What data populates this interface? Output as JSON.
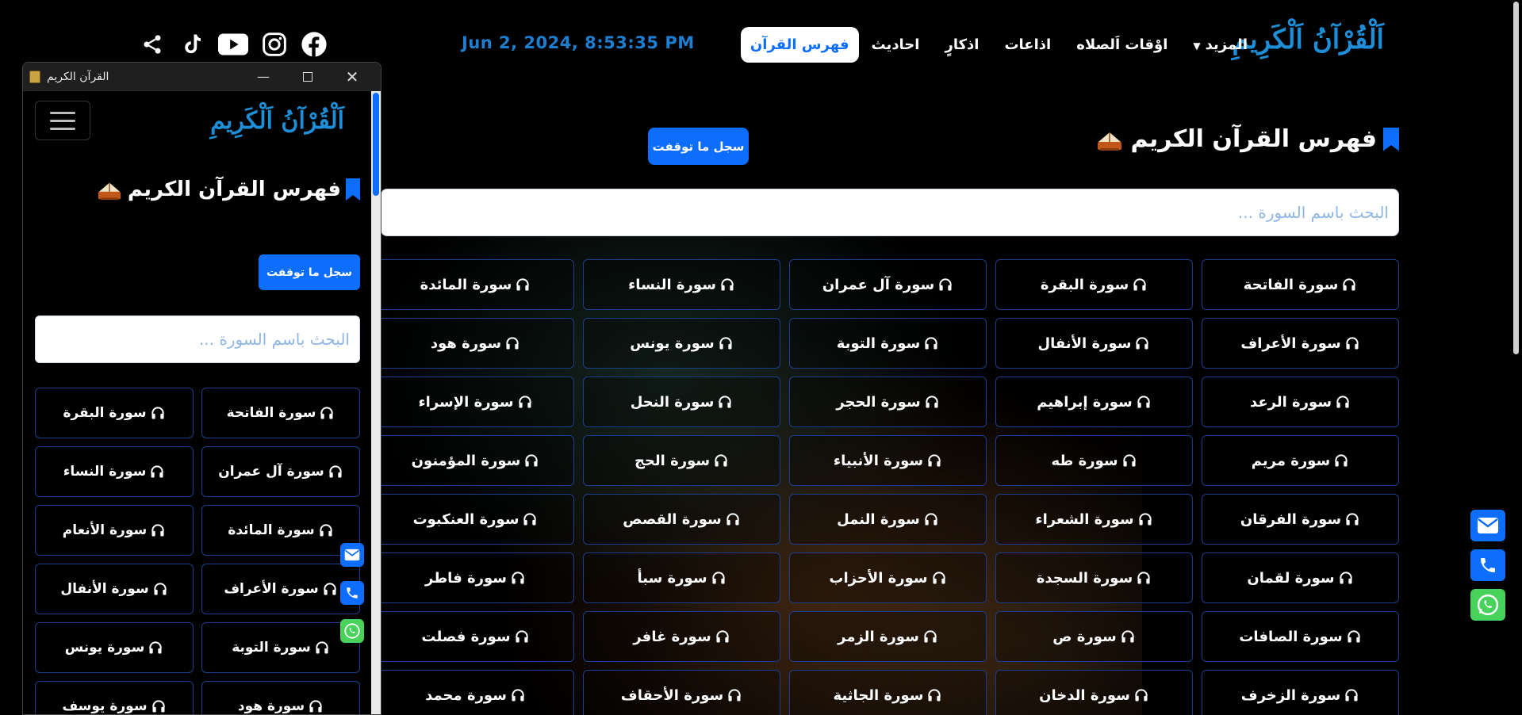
{
  "nav": {
    "brand": "اَلْقُرْآنُ اَلْكَرِيمِ",
    "links": [
      "فهرس القرآن",
      "احاديث",
      "اذكارٍ",
      "اذاعات",
      "اوْقات اَلصلاه",
      "المزيد"
    ],
    "datetime": "Jun 2, 2024, 8:53:35 PM",
    "social_icons": [
      "share-icon",
      "tiktok-icon",
      "youtube-icon",
      "instagram-icon",
      "facebook-icon"
    ]
  },
  "main": {
    "title": "فهرس القرآن الكريم",
    "save_button": "سجل ما توقفت",
    "search_placeholder": "البحث باسم السورة ...",
    "surah_rows": [
      [
        "سورة الفاتحة",
        "سورة البقرة",
        "سورة آل عمران",
        "سورة النساء",
        "سورة المائدة"
      ],
      [
        "سورة الأعراف",
        "سورة الأنفال",
        "سورة التوبة",
        "سورة يونس",
        "سورة هود"
      ],
      [
        "سورة الرعد",
        "سورة إبراهيم",
        "سورة الحجر",
        "سورة النحل",
        "سورة الإسراء"
      ],
      [
        "سورة مريم",
        "سورة طه",
        "سورة الأنبياء",
        "سورة الحج",
        "سورة المؤمنون"
      ],
      [
        "سورة الفرقان",
        "سورة الشعراء",
        "سورة النمل",
        "سورة القصص",
        "سورة العنكبوت"
      ],
      [
        "سورة لقمان",
        "سورة السجدة",
        "سورة الأحزاب",
        "سورة سبأ",
        "سورة فاطر"
      ],
      [
        "سورة الصافات",
        "سورة ص",
        "سورة الزمر",
        "سورة غافر",
        "سورة فصلت"
      ],
      [
        "سورة الزخرف",
        "سورة الدخان",
        "سورة الجاثية",
        "سورة الأحقاف",
        "سورة محمد"
      ]
    ]
  },
  "window": {
    "title": "القرآن الكريم",
    "brand": "اَلْقُرْآنُ اَلْكَرِيمِ",
    "page_title": "فهرس القرآن الكريم",
    "save_button": "سجل ما توقفت",
    "search_placeholder": "البحث باسم السورة ...",
    "surah_rows": [
      [
        "سورة الفاتحة",
        "سورة البقرة"
      ],
      [
        "سورة آل عمران",
        "سورة النساء"
      ],
      [
        "سورة المائدة",
        "سورة الأنعام"
      ],
      [
        "سورة الأعراف",
        "سورة الأنفال"
      ],
      [
        "سورة التوبة",
        "سورة يونس"
      ],
      [
        "سورة هود",
        "سورة يوسف"
      ]
    ]
  },
  "contact_icons": [
    "mail-icon",
    "phone-icon",
    "whatsapp-icon"
  ],
  "colors": {
    "accent": "#0d6efd",
    "brand": "#1d8fd9",
    "whatsapp": "#47d35b",
    "card_border": "#1b3e8a"
  }
}
